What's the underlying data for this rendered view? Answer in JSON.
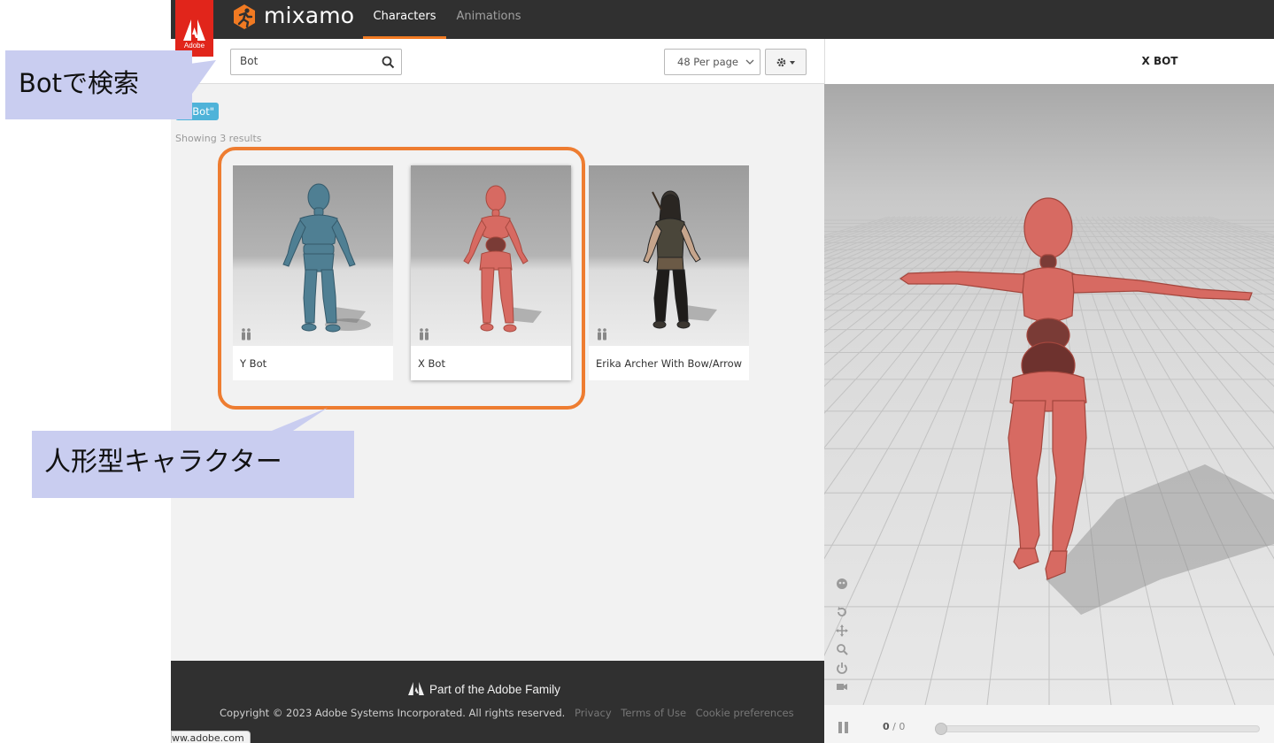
{
  "header": {
    "adobe_word": "Adobe",
    "brand": "mixamo",
    "tabs": [
      {
        "label": "Characters",
        "active": true
      },
      {
        "label": "Animations",
        "active": false
      }
    ],
    "accent_color": "#f17a22"
  },
  "search": {
    "value": "Bot",
    "per_page": "48 Per page"
  },
  "filter_chip": "Bot\"",
  "results_text": "Showing 3 results",
  "characters": [
    {
      "name": "Y Bot",
      "body_color": "#4f7f93"
    },
    {
      "name": "X Bot",
      "body_color": "#d76a62"
    },
    {
      "name": "Erika Archer With Bow/Arrow",
      "body_color": "#3b3630"
    }
  ],
  "viewer": {
    "title": "X BOT",
    "frame_current": "0",
    "frame_total": "/ 0",
    "progress": 0
  },
  "footer": {
    "family": "Part of the Adobe Family",
    "copyright": "Copyright © 2023 Adobe Systems Incorporated. All rights reserved.",
    "links": [
      "Privacy",
      "Terms of Use",
      "Cookie preferences"
    ]
  },
  "url_tooltip": "ww.adobe.com",
  "annotations": {
    "search_note": "Botで検索",
    "characters_note": "人形型キャラクター",
    "highlight_color": "#ee7d31",
    "callout_color": "#c9cdf0"
  }
}
